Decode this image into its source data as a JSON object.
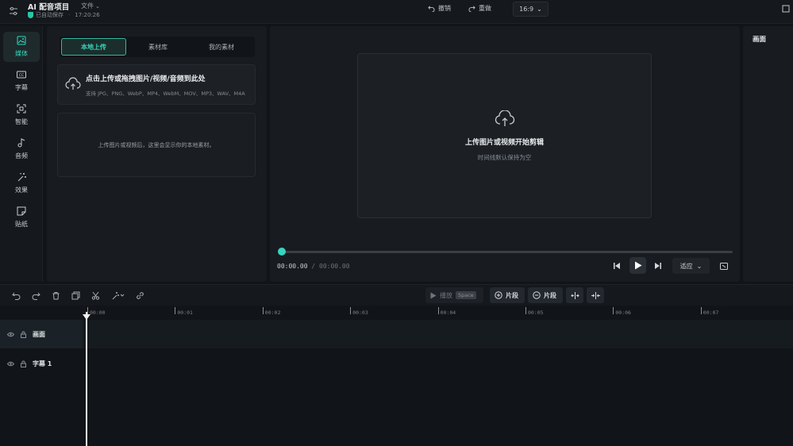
{
  "header": {
    "app_title": "AI 配音项目",
    "file_menu": "文件",
    "saved_status": "已自动保存",
    "saved_time": "17:20:26",
    "undo_label": "撤销",
    "redo_label": "重做",
    "aspect_ratio": "16:9"
  },
  "sidebar": {
    "items": [
      {
        "label": "媒体",
        "icon": "image-icon",
        "active": true
      },
      {
        "label": "字幕",
        "icon": "cc-icon",
        "active": false
      },
      {
        "label": "智能",
        "icon": "smart-scan-icon",
        "active": false
      },
      {
        "label": "音频",
        "icon": "music-note-icon",
        "active": false
      },
      {
        "label": "效果",
        "icon": "magic-wand-icon",
        "active": false
      },
      {
        "label": "贴纸",
        "icon": "sticker-icon",
        "active": false
      }
    ]
  },
  "media_panel": {
    "tabs": [
      {
        "label": "本地上传",
        "active": true
      },
      {
        "label": "素材库",
        "active": false
      },
      {
        "label": "我的素材",
        "active": false
      }
    ],
    "upload_title": "点击上传或拖拽图片/视频/音频到此处",
    "upload_formats": "支持 JPG、PNG、WebP、MP4、WebM、MOV、MP3、WAV、M4A",
    "empty_hint": "上传图片或视频后，这里会显示你的本地素材。"
  },
  "preview": {
    "canvas_title": "上传图片或视频开始剪辑",
    "canvas_subtitle": "时间线默认保持为空",
    "current_time": "00:00.00",
    "separator": "/",
    "total_time": "00:00.00",
    "fit_label": "适应",
    "playback_progress": 0
  },
  "properties": {
    "title": "画面"
  },
  "timeline_toolbar": {
    "split_label": "播放",
    "split_key": "Space",
    "add_segment_label": "片段",
    "remove_segment_label": "片段"
  },
  "ruler": {
    "ticks": [
      "00:00",
      "00:01",
      "00:02",
      "00:03",
      "00:04",
      "00:05",
      "00:06",
      "00:07"
    ]
  },
  "tracks": [
    {
      "name": "画面"
    },
    {
      "name": "字幕 1"
    }
  ],
  "colors": {
    "accent": "#35d6bd",
    "background": "#111418",
    "panel": "#181b20"
  }
}
